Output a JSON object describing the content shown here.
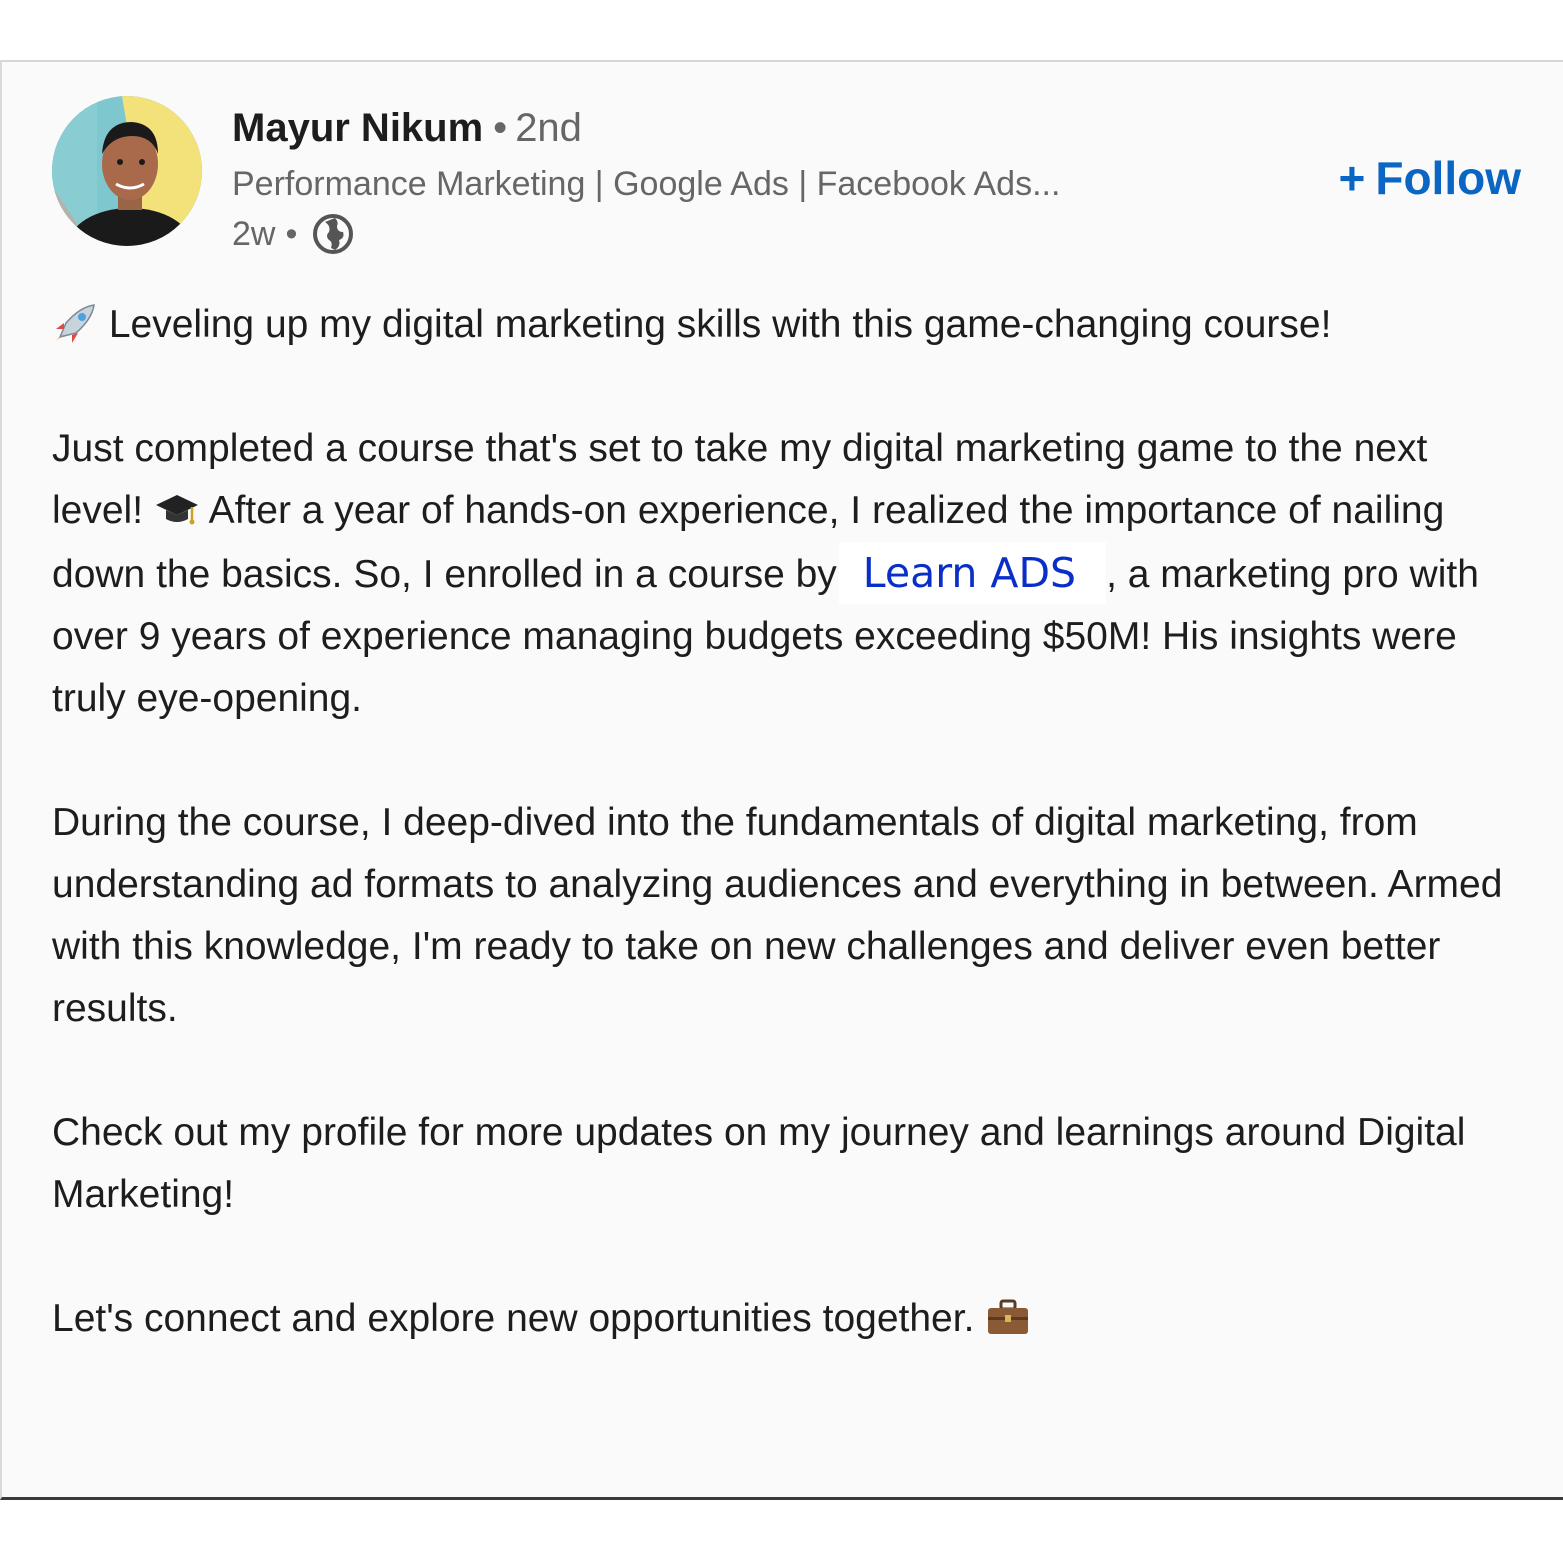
{
  "post": {
    "author": {
      "name": "Mayur Nikum",
      "separator": "•",
      "degree": "2nd",
      "headline": "Performance Marketing | Google Ads | Facebook Ads...",
      "time": "2w",
      "time_separator": "•",
      "visibility_icon": "globe-icon",
      "avatar_colors": [
        "#7fc7cf",
        "#f3e27a",
        "#e58b6b"
      ]
    },
    "follow_button": {
      "icon": "+",
      "label": "Follow",
      "color": "#0a66c2"
    },
    "body": {
      "p1_emoji": "rocket-emoji",
      "p1_text": "Leveling up my digital marketing skills with this game-changing course!",
      "p2_text_a": "Just completed a course that's set to take my digital marketing game to the next level!",
      "p2_emoji": "graduation-cap-emoji",
      "p2_text_b": "After a year of hands-on experience, I realized the importance of nailing down the basics. So, I enrolled in a course by",
      "mention": "Learn ADS",
      "p2_text_c": ", a marketing pro with over 9 years of experience managing budgets exceeding $50M! His insights were truly eye-opening.",
      "p3_text": "During the course, I deep-dived into the fundamentals of digital marketing, from understanding ad formats to analyzing audiences and everything in between. Armed with this knowledge, I'm ready to take on new challenges and deliver even better results.",
      "p4_text": "Check out my profile for more updates on my journey and learnings around Digital Marketing!",
      "p5_text": "Let's connect and explore new opportunities together.",
      "p5_emoji": "briefcase-emoji"
    }
  }
}
